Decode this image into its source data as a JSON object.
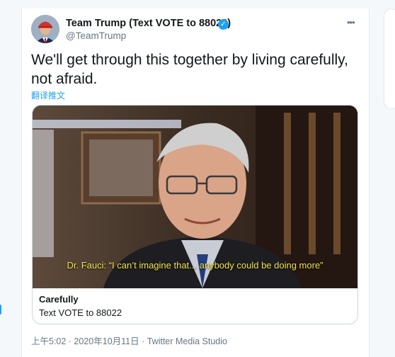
{
  "author": {
    "display_name": "Team Trump (Text VOTE to 88022)",
    "handle": "@TeamTrump",
    "verified_icon": "✓"
  },
  "tweet": {
    "text": "We'll get through this together by living carefully, not afraid.",
    "translate_label": "翻译推文"
  },
  "more_icon": "•••",
  "media": {
    "caption": "Dr. Fauci: “I can’t imagine that... anybody could be doing more”",
    "card_title": "Carefully",
    "card_description": "Text VOTE to 88022"
  },
  "meta": {
    "timestamp": "上午5:02 · 2020年10月11日 · Twitter Media Studio"
  },
  "colors": {
    "accent": "#1da1f2",
    "text": "#14171a",
    "secondary": "#657786",
    "caption": "#f2e24a"
  }
}
